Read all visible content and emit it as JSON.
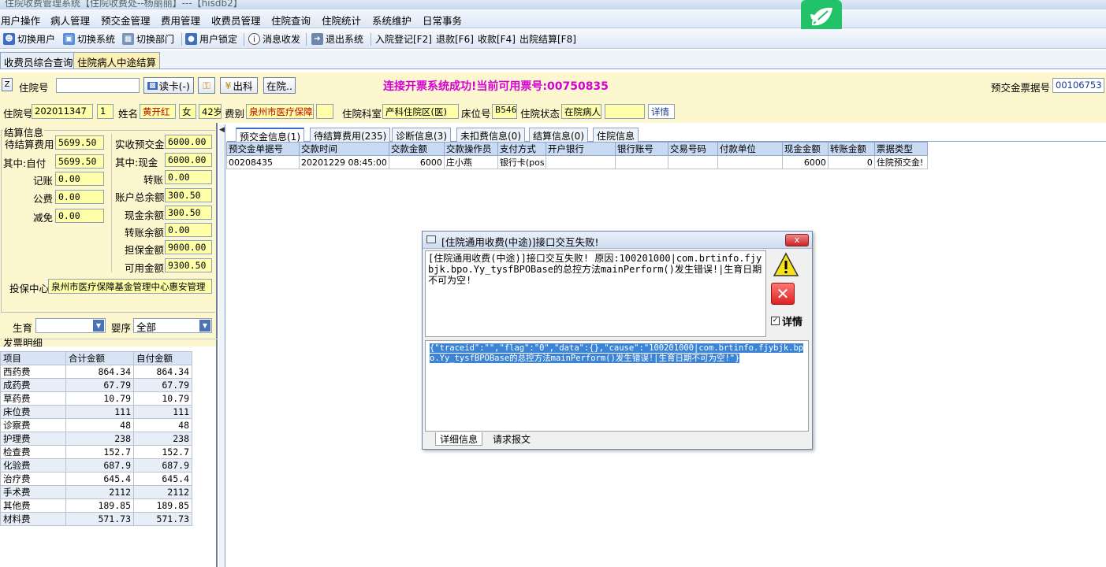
{
  "window": {
    "title": "住院收费管理系统【住院收费处--杨丽丽】---【hisdb2】"
  },
  "menu": [
    "用户操作",
    "病人管理",
    "预交金管理",
    "费用管理",
    "收费员管理",
    "住院查询",
    "住院统计",
    "系统维护",
    "日常事务"
  ],
  "toolbar": [
    "切换用户",
    "切换系统",
    "切换部门",
    "用户锁定",
    "消息收发",
    "退出系统",
    "入院登记[F2]",
    "退款[F6]",
    "收款[F4]",
    "出院结算[F8]"
  ],
  "page_tabs": [
    "收费员综合查询",
    "住院病人中途结算"
  ],
  "search": {
    "z_label": "Z",
    "inpatient_no_label": "住院号",
    "inpatient_no_value": "",
    "read_card_button": "读卡(-)",
    "charge_button": "出科",
    "hospital_button": "在院.."
  },
  "banner": "连接开票系统成功!当前可用票号:00750835",
  "deposit_receipt": {
    "label": "预交金票据号",
    "value": "00106753"
  },
  "patient": {
    "inpatient_no_label": "住院号",
    "inpatient_no": "202011347",
    "times": "1",
    "name_label": "姓名",
    "name": "黄开红",
    "sex": "女",
    "age": "42岁",
    "fee_type_label": "费别",
    "fee_type": "泉州市医疗保障",
    "dept_label": "住院科室",
    "dept": "产科住院区(医)",
    "bed_label": "床位号",
    "bed": "B546",
    "status_label": "住院状态",
    "status": "在院病人",
    "status_extra": "",
    "detail_link": "详情"
  },
  "settlement": {
    "group_title": "结算信息",
    "pending_fee_label": "待结算费用",
    "pending_fee": "5699.50",
    "self_pay_label": "其中:自付",
    "self_pay": "5699.50",
    "account_label": "记账",
    "account": "0.00",
    "public_fee_label": "公费",
    "public_fee": "0.00",
    "reduction_label": "减免",
    "reduction": "0.00",
    "received_deposit_label": "实收预交金",
    "received_deposit": "6000.00",
    "cash_label": "其中:现金",
    "cash": "6000.00",
    "transfer_label": "转账",
    "transfer": "0.00",
    "account_total_label": "账户总余额",
    "account_total": "300.50",
    "cash_balance_label": "现金余额",
    "cash_balance": "300.50",
    "transfer_balance_label": "转账余额",
    "transfer_balance": "0.00",
    "guarantee_label": "担保金额",
    "guarantee": "9000.00",
    "available_label": "可用金额",
    "available": "9300.50",
    "insurance_center_label": "投保中心",
    "insurance_center": "泉州市医疗保障基金管理中心惠安管理",
    "birth_label": "生育",
    "birth_value": "",
    "infant_label": "婴序",
    "infant_value": "全部"
  },
  "invoice": {
    "group_title": "发票明细",
    "headers": [
      "项目",
      "合计金额",
      "自付金额"
    ],
    "rows": [
      [
        "西药费",
        "864.34",
        "864.34"
      ],
      [
        "成药费",
        "67.79",
        "67.79"
      ],
      [
        "草药费",
        "10.79",
        "10.79"
      ],
      [
        "床位费",
        "111",
        "111"
      ],
      [
        "诊察费",
        "48",
        "48"
      ],
      [
        "护理费",
        "238",
        "238"
      ],
      [
        "检查费",
        "152.7",
        "152.7"
      ],
      [
        "化验费",
        "687.9",
        "687.9"
      ],
      [
        "治疗费",
        "645.4",
        "645.4"
      ],
      [
        "手术费",
        "2112",
        "2112"
      ],
      [
        "其他费",
        "189.85",
        "189.85"
      ],
      [
        "材料费",
        "571.73",
        "571.73"
      ]
    ]
  },
  "inner_tabs": [
    "预交金信息(1)",
    "待结算费用(235)",
    "诊断信息(3)",
    "未扣费信息(0)",
    "结算信息(0)",
    "住院信息"
  ],
  "deposit_grid": {
    "headers": [
      "预交金单据号",
      "交款时间",
      "交款金额",
      "交款操作员",
      "支付方式",
      "开户银行",
      "银行账号",
      "交易号码",
      "付款单位",
      "现金金额",
      "转账金额",
      "票据类型"
    ],
    "rows": [
      [
        "00208435",
        "20201229 08:45:00",
        "6000",
        "庄小燕",
        "银行卡(pos",
        "",
        "",
        "",
        "",
        "6000",
        "0",
        "住院预交金!"
      ]
    ]
  },
  "dialog": {
    "title": "[住院通用收费(中途)]接口交互失败!",
    "message": "[住院通用收费(中途)]接口交互失败! 原因:100201000|com.brtinfo.fjybjk.bpo.Yy_tysfBPOBase的总控方法mainPerform()发生错误!|生育日期不可为空!",
    "detail": "{\"traceid\":\"\",\"flag\":\"0\",\"data\":{},\"cause\":\"100201000|com.brtinfo.fjybjk.bpo.Yy_tysfBPOBase的总控方法mainPerform()发生错误!|生育日期不可为空!\"}",
    "details_checkbox": "详情",
    "tabs": [
      "详细信息",
      "请求报文"
    ],
    "close_label": "x"
  }
}
